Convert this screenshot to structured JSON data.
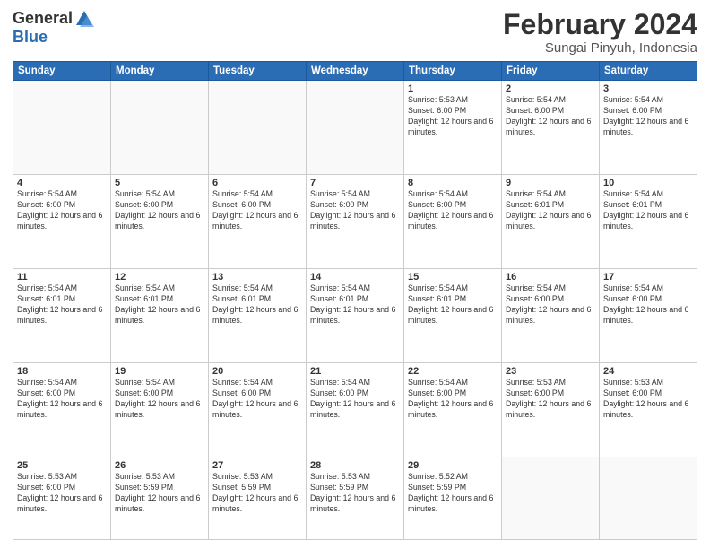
{
  "logo": {
    "general": "General",
    "blue": "Blue"
  },
  "header": {
    "title": "February 2024",
    "subtitle": "Sungai Pinyuh, Indonesia"
  },
  "weekdays": [
    "Sunday",
    "Monday",
    "Tuesday",
    "Wednesday",
    "Thursday",
    "Friday",
    "Saturday"
  ],
  "weeks": [
    [
      {
        "day": "",
        "empty": true
      },
      {
        "day": "",
        "empty": true
      },
      {
        "day": "",
        "empty": true
      },
      {
        "day": "",
        "empty": true
      },
      {
        "day": "1",
        "sunrise": "Sunrise: 5:53 AM",
        "sunset": "Sunset: 6:00 PM",
        "daylight": "Daylight: 12 hours and 6 minutes."
      },
      {
        "day": "2",
        "sunrise": "Sunrise: 5:54 AM",
        "sunset": "Sunset: 6:00 PM",
        "daylight": "Daylight: 12 hours and 6 minutes."
      },
      {
        "day": "3",
        "sunrise": "Sunrise: 5:54 AM",
        "sunset": "Sunset: 6:00 PM",
        "daylight": "Daylight: 12 hours and 6 minutes."
      }
    ],
    [
      {
        "day": "4",
        "sunrise": "Sunrise: 5:54 AM",
        "sunset": "Sunset: 6:00 PM",
        "daylight": "Daylight: 12 hours and 6 minutes."
      },
      {
        "day": "5",
        "sunrise": "Sunrise: 5:54 AM",
        "sunset": "Sunset: 6:00 PM",
        "daylight": "Daylight: 12 hours and 6 minutes."
      },
      {
        "day": "6",
        "sunrise": "Sunrise: 5:54 AM",
        "sunset": "Sunset: 6:00 PM",
        "daylight": "Daylight: 12 hours and 6 minutes."
      },
      {
        "day": "7",
        "sunrise": "Sunrise: 5:54 AM",
        "sunset": "Sunset: 6:00 PM",
        "daylight": "Daylight: 12 hours and 6 minutes."
      },
      {
        "day": "8",
        "sunrise": "Sunrise: 5:54 AM",
        "sunset": "Sunset: 6:00 PM",
        "daylight": "Daylight: 12 hours and 6 minutes."
      },
      {
        "day": "9",
        "sunrise": "Sunrise: 5:54 AM",
        "sunset": "Sunset: 6:01 PM",
        "daylight": "Daylight: 12 hours and 6 minutes."
      },
      {
        "day": "10",
        "sunrise": "Sunrise: 5:54 AM",
        "sunset": "Sunset: 6:01 PM",
        "daylight": "Daylight: 12 hours and 6 minutes."
      }
    ],
    [
      {
        "day": "11",
        "sunrise": "Sunrise: 5:54 AM",
        "sunset": "Sunset: 6:01 PM",
        "daylight": "Daylight: 12 hours and 6 minutes."
      },
      {
        "day": "12",
        "sunrise": "Sunrise: 5:54 AM",
        "sunset": "Sunset: 6:01 PM",
        "daylight": "Daylight: 12 hours and 6 minutes."
      },
      {
        "day": "13",
        "sunrise": "Sunrise: 5:54 AM",
        "sunset": "Sunset: 6:01 PM",
        "daylight": "Daylight: 12 hours and 6 minutes."
      },
      {
        "day": "14",
        "sunrise": "Sunrise: 5:54 AM",
        "sunset": "Sunset: 6:01 PM",
        "daylight": "Daylight: 12 hours and 6 minutes."
      },
      {
        "day": "15",
        "sunrise": "Sunrise: 5:54 AM",
        "sunset": "Sunset: 6:01 PM",
        "daylight": "Daylight: 12 hours and 6 minutes."
      },
      {
        "day": "16",
        "sunrise": "Sunrise: 5:54 AM",
        "sunset": "Sunset: 6:00 PM",
        "daylight": "Daylight: 12 hours and 6 minutes."
      },
      {
        "day": "17",
        "sunrise": "Sunrise: 5:54 AM",
        "sunset": "Sunset: 6:00 PM",
        "daylight": "Daylight: 12 hours and 6 minutes."
      }
    ],
    [
      {
        "day": "18",
        "sunrise": "Sunrise: 5:54 AM",
        "sunset": "Sunset: 6:00 PM",
        "daylight": "Daylight: 12 hours and 6 minutes."
      },
      {
        "day": "19",
        "sunrise": "Sunrise: 5:54 AM",
        "sunset": "Sunset: 6:00 PM",
        "daylight": "Daylight: 12 hours and 6 minutes."
      },
      {
        "day": "20",
        "sunrise": "Sunrise: 5:54 AM",
        "sunset": "Sunset: 6:00 PM",
        "daylight": "Daylight: 12 hours and 6 minutes."
      },
      {
        "day": "21",
        "sunrise": "Sunrise: 5:54 AM",
        "sunset": "Sunset: 6:00 PM",
        "daylight": "Daylight: 12 hours and 6 minutes."
      },
      {
        "day": "22",
        "sunrise": "Sunrise: 5:54 AM",
        "sunset": "Sunset: 6:00 PM",
        "daylight": "Daylight: 12 hours and 6 minutes."
      },
      {
        "day": "23",
        "sunrise": "Sunrise: 5:53 AM",
        "sunset": "Sunset: 6:00 PM",
        "daylight": "Daylight: 12 hours and 6 minutes."
      },
      {
        "day": "24",
        "sunrise": "Sunrise: 5:53 AM",
        "sunset": "Sunset: 6:00 PM",
        "daylight": "Daylight: 12 hours and 6 minutes."
      }
    ],
    [
      {
        "day": "25",
        "sunrise": "Sunrise: 5:53 AM",
        "sunset": "Sunset: 6:00 PM",
        "daylight": "Daylight: 12 hours and 6 minutes."
      },
      {
        "day": "26",
        "sunrise": "Sunrise: 5:53 AM",
        "sunset": "Sunset: 5:59 PM",
        "daylight": "Daylight: 12 hours and 6 minutes."
      },
      {
        "day": "27",
        "sunrise": "Sunrise: 5:53 AM",
        "sunset": "Sunset: 5:59 PM",
        "daylight": "Daylight: 12 hours and 6 minutes."
      },
      {
        "day": "28",
        "sunrise": "Sunrise: 5:53 AM",
        "sunset": "Sunset: 5:59 PM",
        "daylight": "Daylight: 12 hours and 6 minutes."
      },
      {
        "day": "29",
        "sunrise": "Sunrise: 5:52 AM",
        "sunset": "Sunset: 5:59 PM",
        "daylight": "Daylight: 12 hours and 6 minutes."
      },
      {
        "day": "",
        "empty": true
      },
      {
        "day": "",
        "empty": true
      }
    ]
  ]
}
